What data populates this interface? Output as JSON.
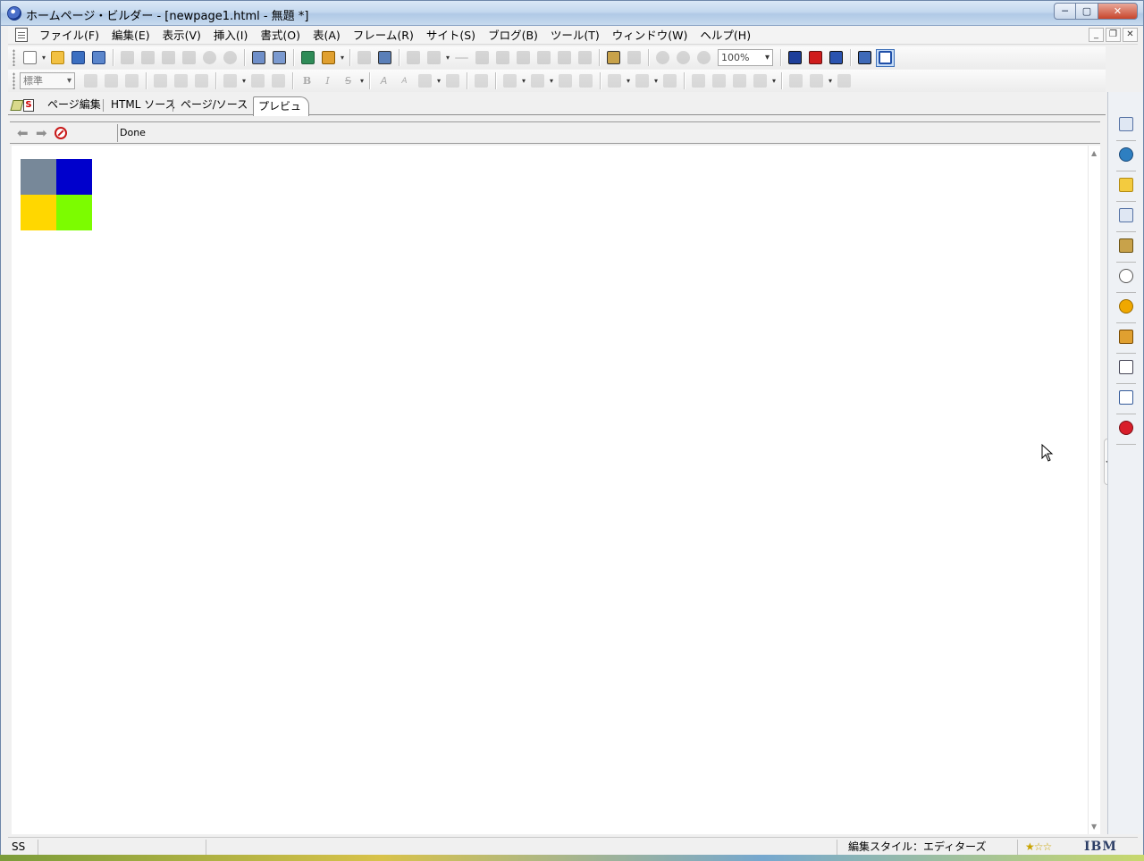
{
  "window": {
    "title": "ホームページ・ビルダー - [newpage1.html - 無題 *]",
    "caption_minimize": "─",
    "caption_maximize": "▢",
    "caption_close": "✕"
  },
  "menu": {
    "items": [
      "ファイル(F)",
      "編集(E)",
      "表示(V)",
      "挿入(I)",
      "書式(O)",
      "表(A)",
      "フレーム(R)",
      "サイト(S)",
      "ブログ(B)",
      "ツール(T)",
      "ウィンドウ(W)",
      "ヘルプ(H)"
    ]
  },
  "toolbar": {
    "zoom_value": "100%",
    "style_value": "標準"
  },
  "tabs": {
    "items": [
      "ページ編集",
      "HTML ソース",
      "ページ/ソース"
    ],
    "active": "プレビュー"
  },
  "browser": {
    "status": "Done"
  },
  "content": {
    "grid_colors": [
      "#778899",
      "#0000cc",
      "#ffd700",
      "#7cfc00"
    ]
  },
  "statusbar": {
    "left": "SS",
    "edit_style": "編集スタイル：エディターズ",
    "brand": "IBM",
    "rating": "★☆☆"
  },
  "colors": {
    "accent": "#3c6fb8",
    "titlebar": "#c4d8ee"
  }
}
